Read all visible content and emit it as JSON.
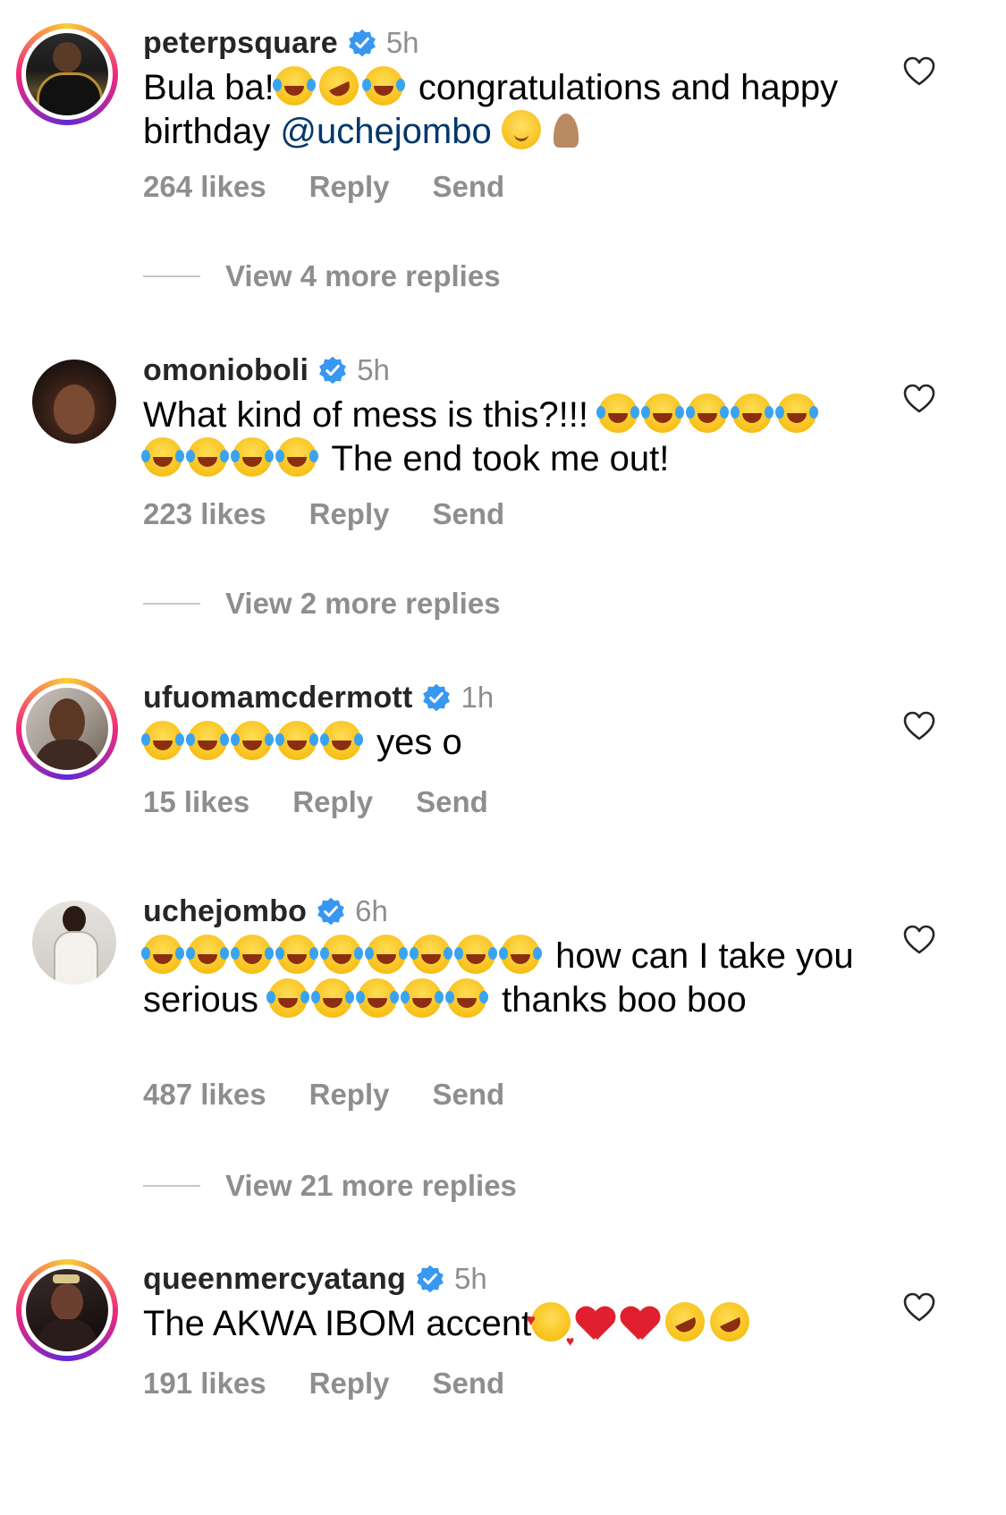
{
  "colors": {
    "muted": "#8e8e8e",
    "verified": "#3897f0",
    "mention": "#00376b"
  },
  "comments": [
    {
      "username": "peterpsquare",
      "time": "5h",
      "text_a": "Bula ba!",
      "text_b": " congratulations and happy birthday ",
      "mention": "@uchejombo",
      "likes": "264 likes",
      "reply": "Reply",
      "send": "Send",
      "view_replies": "View 4 more replies"
    },
    {
      "username": "omonioboli",
      "time": "5h",
      "text_a": "What kind of mess is this?!!! ",
      "text_b": " The end took me out!",
      "likes": "223 likes",
      "reply": "Reply",
      "send": "Send",
      "view_replies": "View 2 more replies"
    },
    {
      "username": "ufuomamcdermott",
      "time": "1h",
      "text_b": " yes o",
      "likes": "15 likes",
      "reply": "Reply",
      "send": "Send"
    },
    {
      "username": "uchejombo",
      "time": "6h",
      "text_a": " how can I take you serious ",
      "text_b": " thanks boo boo",
      "likes": "487 likes",
      "reply": "Reply",
      "send": "Send",
      "view_replies": "View 21 more replies"
    },
    {
      "username": "queenmercyatang",
      "time": "5h",
      "text_a": "The AKWA IBOM accent",
      "likes": "191 likes",
      "reply": "Reply",
      "send": "Send"
    }
  ]
}
